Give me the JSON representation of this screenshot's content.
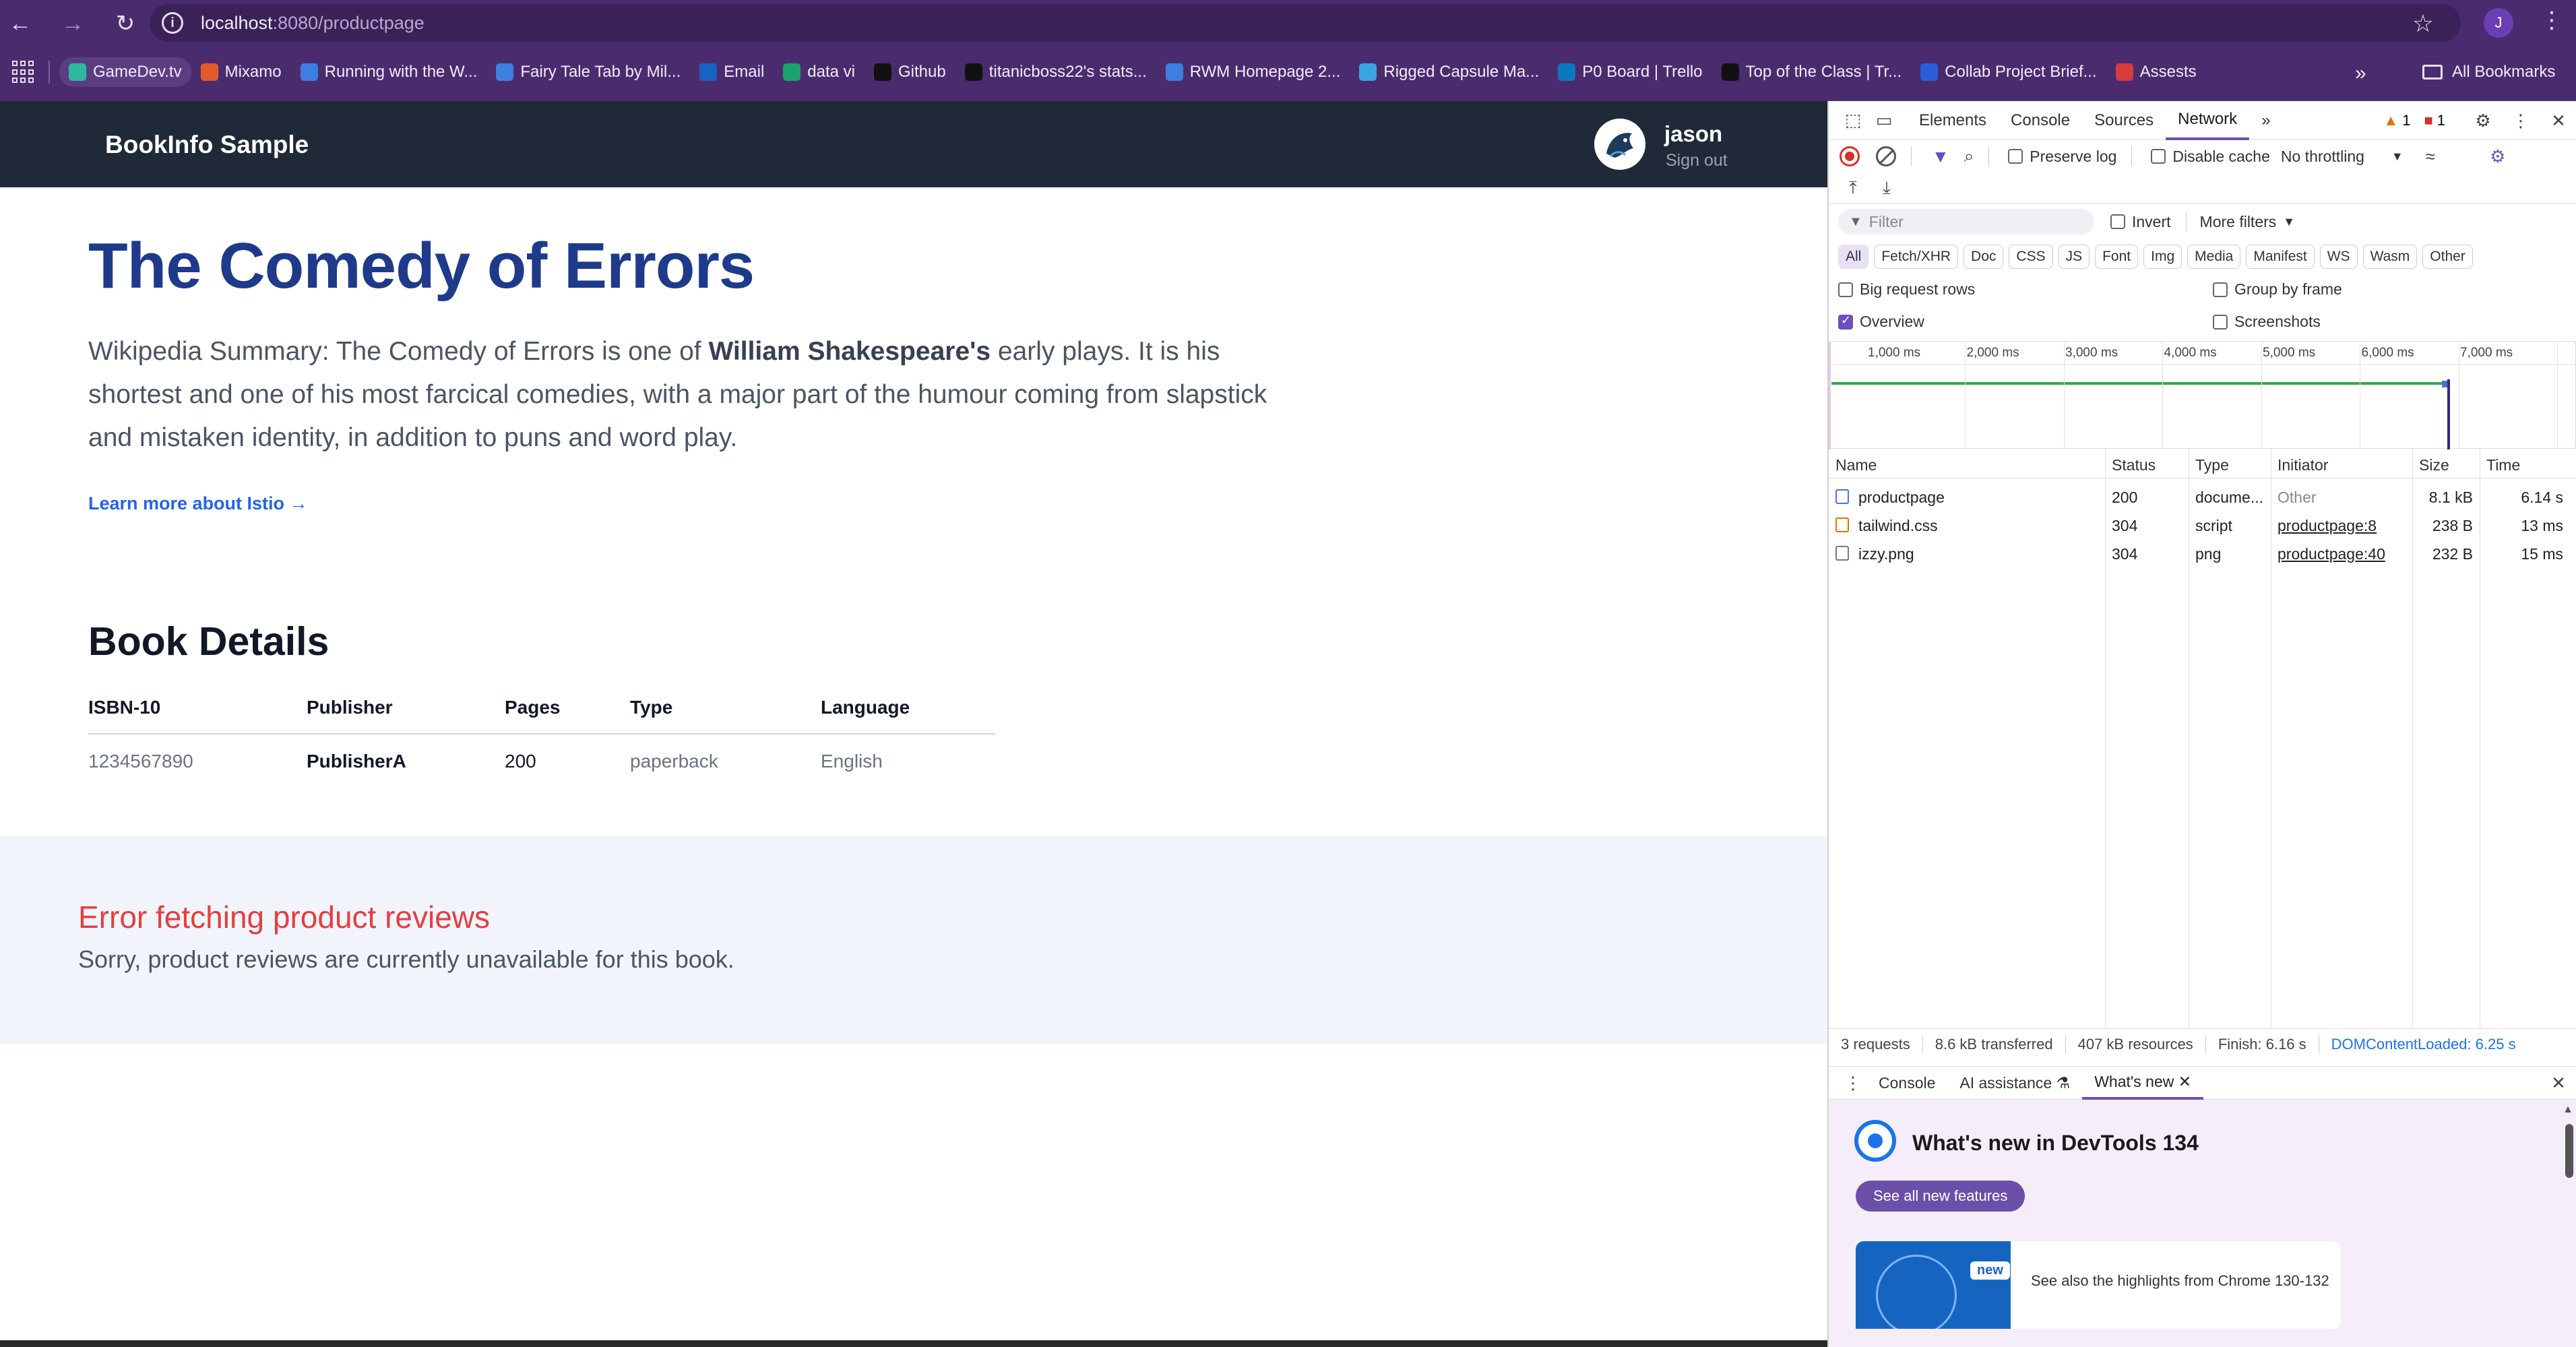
{
  "browser": {
    "url_host": "localhost",
    "url_path": ":8080/productpage",
    "profile_initial": "J",
    "bookmarks": [
      {
        "label": "GameDev.tv",
        "color": "#2eb8a0"
      },
      {
        "label": "Mixamo",
        "color": "#e35b2c"
      },
      {
        "label": "Running with the W...",
        "color": "#3d7fe0"
      },
      {
        "label": "Fairy Tale Tab by Mil...",
        "color": "#3d7fe0"
      },
      {
        "label": "Email",
        "color": "#1565c0"
      },
      {
        "label": "data vi",
        "color": "#1aa36b"
      },
      {
        "label": "Github",
        "color": "#111111"
      },
      {
        "label": "titanicboss22's stats...",
        "color": "#111111"
      },
      {
        "label": "RWM Homepage 2...",
        "color": "#3d7fe0"
      },
      {
        "label": "Rigged Capsule Ma...",
        "color": "#3aa3e0"
      },
      {
        "label": "P0 Board | Trello",
        "color": "#0a79bf"
      },
      {
        "label": "Top of the Class | Tr...",
        "color": "#111111"
      },
      {
        "label": "Collab Project Brief...",
        "color": "#2b5fd9"
      },
      {
        "label": "Assests",
        "color": "#d83b3b"
      }
    ],
    "more_label": "»",
    "all_bookmarks_label": "All Bookmarks"
  },
  "app": {
    "brand": "BookInfo Sample",
    "user_name": "jason",
    "sign_out": "Sign out",
    "title": "The Comedy of Errors",
    "summary_prefix": "Wikipedia Summary: The Comedy of Errors is one of ",
    "summary_bold": "William Shakespeare's",
    "summary_suffix": " early plays. It is his shortest and one of his most farcical comedies, with a major part of the humour coming from slapstick and mistaken identity, in addition to puns and word play.",
    "learn_more": "Learn more about Istio →",
    "details_heading": "Book Details",
    "details_headers": [
      "ISBN-10",
      "Publisher",
      "Pages",
      "Type",
      "Language"
    ],
    "details_row": [
      "1234567890",
      "PublisherA",
      "200",
      "paperback",
      "English"
    ],
    "reviews_error_title": "Error fetching product reviews",
    "reviews_error_msg": "Sorry, product reviews are currently unavailable for this book."
  },
  "devtools": {
    "tabs": [
      "Elements",
      "Console",
      "Sources",
      "Network"
    ],
    "active_tab": "Network",
    "more_tabs": "»",
    "warnings": "1",
    "errors": "1",
    "toolbar": {
      "preserve_log": "Preserve log",
      "disable_cache": "Disable cache",
      "throttling": "No throttling"
    },
    "filter_placeholder": "Filter",
    "invert": "Invert",
    "more_filters": "More filters",
    "types": [
      "All",
      "Fetch/XHR",
      "Doc",
      "CSS",
      "JS",
      "Font",
      "Img",
      "Media",
      "Manifest",
      "WS",
      "Wasm",
      "Other"
    ],
    "options": {
      "big_rows": "Big request rows",
      "group_frame": "Group by frame",
      "overview": "Overview",
      "screenshots": "Screenshots"
    },
    "overview_ticks": [
      "1,000 ms",
      "2,000 ms",
      "3,000 ms",
      "4,000 ms",
      "5,000 ms",
      "6,000 ms",
      "7,000 ms"
    ],
    "columns": [
      "Name",
      "Status",
      "Type",
      "Initiator",
      "Size",
      "Time"
    ],
    "requests": [
      {
        "name": "productpage",
        "status": "200",
        "type": "docume...",
        "initiator": "Other",
        "size": "8.1 kB",
        "time": "6.14 s",
        "icon_color": "#4a74d8"
      },
      {
        "name": "tailwind.css",
        "status": "304",
        "type": "script",
        "initiator": "productpage:8",
        "size": "238 B",
        "time": "13 ms",
        "icon_color": "#e37400"
      },
      {
        "name": "izzy.png",
        "status": "304",
        "type": "png",
        "initiator": "productpage:40",
        "size": "232 B",
        "time": "15 ms",
        "icon_color": "#7a7a7a"
      }
    ],
    "status_bar": {
      "requests": "3 requests",
      "transferred": "8.6 kB transferred",
      "resources": "407 kB resources",
      "finish": "Finish: 6.16 s",
      "dcl": "DOMContentLoaded: 6.25 s"
    },
    "drawer_tabs": [
      "Console",
      "AI assistance ⚗",
      "What's new ✕"
    ],
    "whats_new_title": "What's new in DevTools 134",
    "see_all": "See all new features",
    "new_badge": "new",
    "highlights": "See also the highlights from Chrome 130-132"
  }
}
